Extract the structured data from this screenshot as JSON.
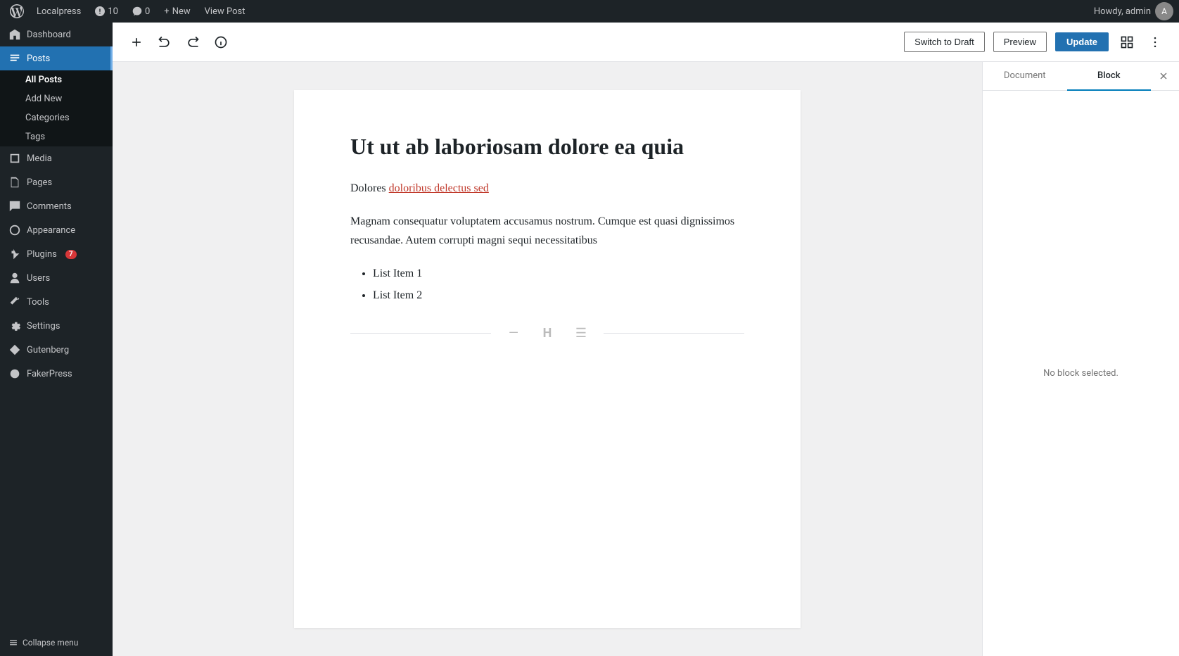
{
  "adminBar": {
    "siteName": "Localpress",
    "updateCount": "10",
    "commentCount": "0",
    "newLabel": "New",
    "viewPostLabel": "View Post",
    "howdy": "Howdy, admin"
  },
  "toolbar": {
    "switchDraftLabel": "Switch to Draft",
    "previewLabel": "Preview",
    "updateLabel": "Update"
  },
  "sidebar": {
    "items": [
      {
        "label": "Dashboard",
        "icon": "dashboard"
      },
      {
        "label": "Posts",
        "icon": "posts",
        "active": true
      },
      {
        "label": "Media",
        "icon": "media"
      },
      {
        "label": "Pages",
        "icon": "pages"
      },
      {
        "label": "Comments",
        "icon": "comments"
      },
      {
        "label": "Appearance",
        "icon": "appearance"
      },
      {
        "label": "Plugins",
        "icon": "plugins",
        "badge": "7"
      },
      {
        "label": "Users",
        "icon": "users"
      },
      {
        "label": "Tools",
        "icon": "tools"
      },
      {
        "label": "Settings",
        "icon": "settings"
      },
      {
        "label": "Gutenberg",
        "icon": "gutenberg"
      },
      {
        "label": "FakerPress",
        "icon": "fakerpress"
      }
    ],
    "postsSubItems": [
      {
        "label": "All Posts",
        "active": true
      },
      {
        "label": "Add New"
      },
      {
        "label": "Categories"
      },
      {
        "label": "Tags"
      }
    ],
    "collapseMenuLabel": "Collapse menu"
  },
  "post": {
    "title": "Ut ut ab laboriosam dolore ea quia",
    "paragraph1": "Dolores ",
    "paragraph1Link": "doloribus delectus sed",
    "paragraph2": "Magnam consequatur voluptatem accusamus nostrum. Cumque est quasi dignissimos recusandae. Autem corrupti magni sequi necessitatibus",
    "listItems": [
      "List Item 1",
      "List Item 2"
    ]
  },
  "rightPanel": {
    "documentTab": "Document",
    "blockTab": "Block",
    "activeTab": "Block",
    "noBlockSelected": "No block selected."
  }
}
